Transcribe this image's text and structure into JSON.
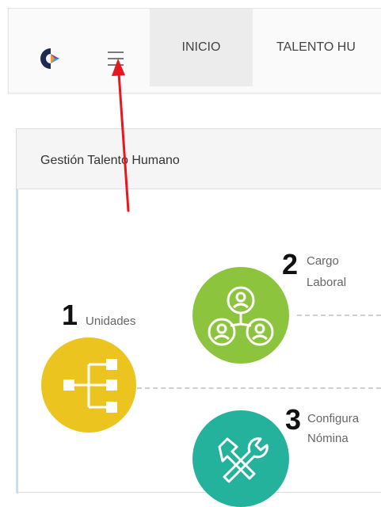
{
  "navbar": {
    "logo_icon": "brand-logo",
    "menu_icon": "hamburger-menu-icon",
    "items": [
      {
        "label": "INICIO",
        "active": true
      },
      {
        "label": "TALENTO HU"
      }
    ]
  },
  "panel": {
    "title": "Gestión Talento Humano"
  },
  "steps": [
    {
      "number": "1",
      "label_lines": [
        "Unidades"
      ],
      "icon": "org-chart-icon",
      "color": "#ecc41f"
    },
    {
      "number": "2",
      "label_lines": [
        "Cargo",
        "Laboral"
      ],
      "icon": "user-group-icon",
      "color": "#8dc43e"
    },
    {
      "number": "3",
      "label_lines": [
        "Configura",
        "Nómina"
      ],
      "icon": "tools-icon",
      "color": "#24b29c"
    }
  ],
  "colors": {
    "annotation_arrow": "#e8161f"
  }
}
